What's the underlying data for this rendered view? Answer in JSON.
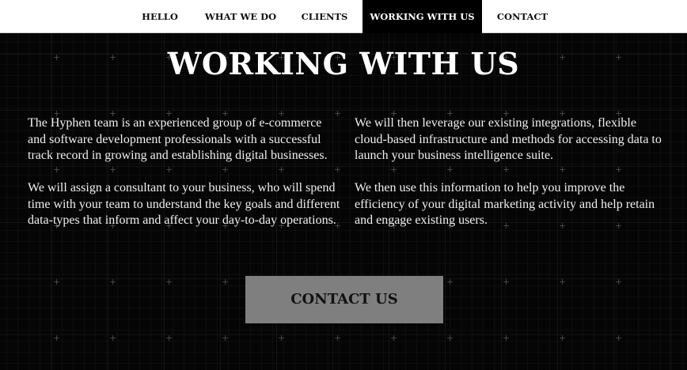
{
  "nav": {
    "items": [
      {
        "label": "HELLO",
        "active": false
      },
      {
        "label": "WHAT WE DO",
        "active": false
      },
      {
        "label": "CLIENTS",
        "active": false
      },
      {
        "label": "WORKING WITH US",
        "active": true
      },
      {
        "label": "CONTACT",
        "active": false
      }
    ]
  },
  "section": {
    "title": "WORKING WITH US",
    "left_paragraphs": [
      "The Hyphen team is an experienced group of e-commerce and software development professionals with a successful track record in growing and establishing digital businesses.",
      "We will assign a consultant to your business, who will spend time with your team to understand the key goals and different data-types that inform and affect your day-to-day operations."
    ],
    "right_paragraphs": [
      "We will then leverage our existing integrations, flexible cloud-based infrastructure and methods for accessing data to launch your business intelligence suite.",
      "We then use this information to help you improve the efficiency of your digital marketing activity and help retain and engage existing users."
    ],
    "cta_label": "CONTACT US"
  },
  "colors": {
    "background": "#000000",
    "nav_background": "#ffffff",
    "nav_active": "#000000",
    "cta_background": "#7f7f7f"
  }
}
